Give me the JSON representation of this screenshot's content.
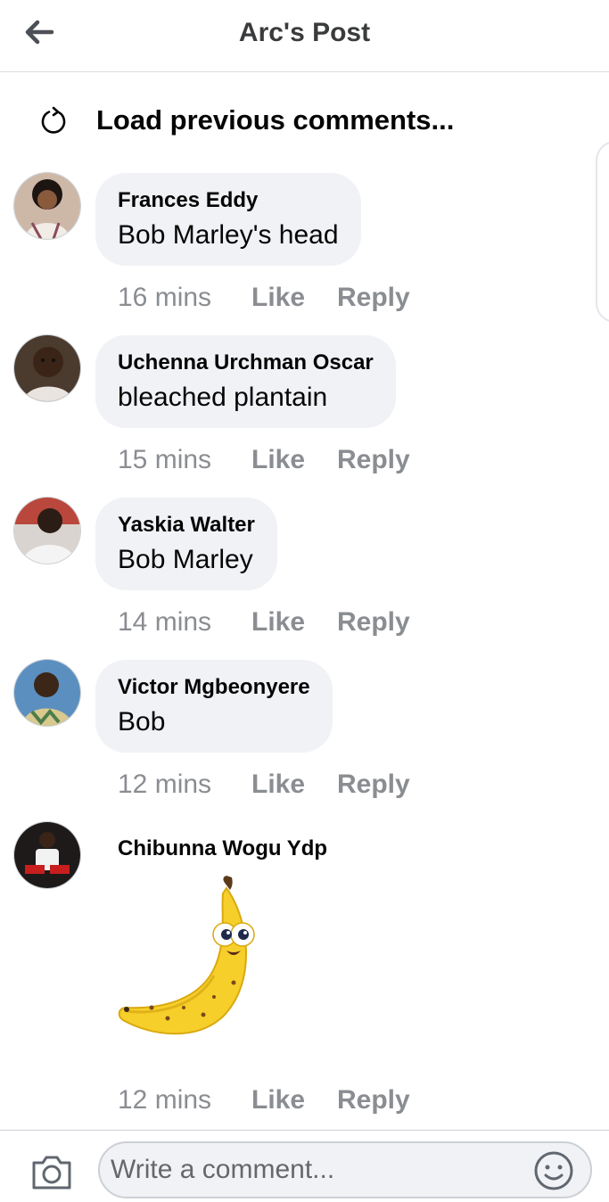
{
  "header": {
    "title": "Arc's Post",
    "back_icon": "arrow-left-icon"
  },
  "load_previous": {
    "label": "Load previous comments...",
    "icon": "refresh-icon"
  },
  "comments": [
    {
      "author": "Frances Eddy",
      "text": "Bob Marley's head",
      "time": "16 mins",
      "like": "Like",
      "reply": "Reply"
    },
    {
      "author": "Uchenna Urchman Oscar",
      "text": "bleached plantain",
      "time": "15 mins",
      "like": "Like",
      "reply": "Reply"
    },
    {
      "author": "Yaskia Walter",
      "text": "Bob Marley",
      "time": "14 mins",
      "like": "Like",
      "reply": "Reply"
    },
    {
      "author": "Victor Mgbeonyere",
      "text": "Bob",
      "time": "12 mins",
      "like": "Like",
      "reply": "Reply"
    },
    {
      "author": "Chibunna Wogu Ydp",
      "sticker": "banana-sticker",
      "time": "12 mins",
      "like": "Like",
      "reply": "Reply"
    }
  ],
  "composer": {
    "placeholder": "Write a comment...",
    "camera_icon": "camera-icon",
    "emoji_icon": "smiley-icon"
  },
  "colors": {
    "bubble": "#f0f2f5",
    "meta_text": "#8a8d91",
    "banana": "#f7cf2a"
  }
}
